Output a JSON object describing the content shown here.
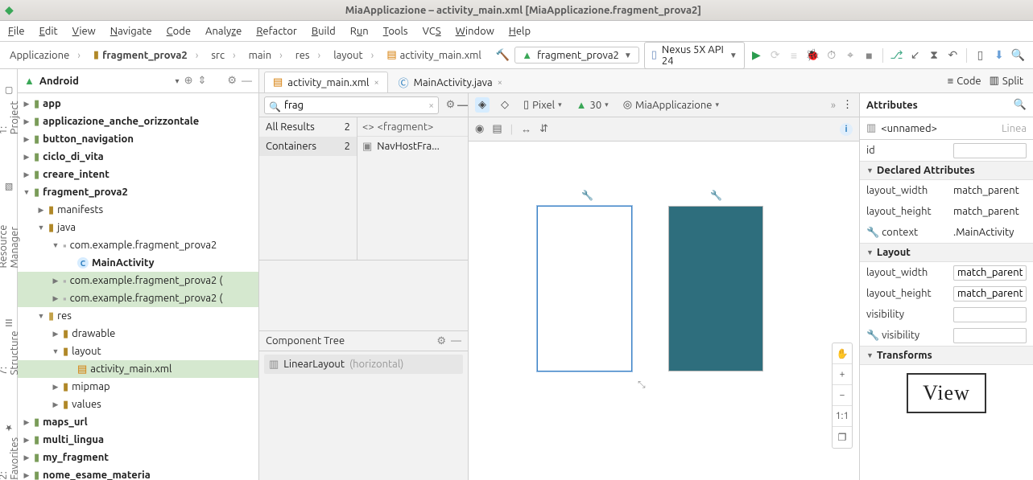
{
  "window": {
    "title": "MiaApplicazione – activity_main.xml [MiaApplicazione.fragment_prova2]"
  },
  "menu": {
    "file": "File",
    "edit": "Edit",
    "view": "View",
    "navigate": "Navigate",
    "code": "Code",
    "analyze": "Analyze",
    "refactor": "Refactor",
    "build": "Build",
    "run": "Run",
    "tools": "Tools",
    "vcs": "VCS",
    "window": "Window",
    "help": "Help"
  },
  "breadcrumbs": [
    "Applicazione",
    "fragment_prova2",
    "src",
    "main",
    "res",
    "layout",
    "activity_main.xml"
  ],
  "run_config": "fragment_prova2",
  "device": "Nexus 5X API 24",
  "proj_header": "Android",
  "left_tabs": {
    "project": "1: Project",
    "resmgr": "Resource Manager",
    "structure": "7: Structure",
    "fav": "2: Favorites"
  },
  "project_tree": [
    {
      "lvl": 0,
      "label": "app",
      "icon": "mod",
      "exp": "▶"
    },
    {
      "lvl": 0,
      "label": "applicazione_anche_orizzontale",
      "icon": "mod",
      "exp": "▶"
    },
    {
      "lvl": 0,
      "label": "button_navigation",
      "icon": "mod",
      "exp": "▶"
    },
    {
      "lvl": 0,
      "label": "ciclo_di_vita",
      "icon": "mod",
      "exp": "▶"
    },
    {
      "lvl": 0,
      "label": "creare_intent",
      "icon": "mod",
      "exp": "▶"
    },
    {
      "lvl": 0,
      "label": "fragment_prova2",
      "icon": "mod",
      "exp": "▼"
    },
    {
      "lvl": 1,
      "label": "manifests",
      "icon": "fold",
      "exp": "▶"
    },
    {
      "lvl": 1,
      "label": "java",
      "icon": "fold",
      "exp": "▼"
    },
    {
      "lvl": 2,
      "label": "com.example.fragment_prova2",
      "icon": "pkg",
      "exp": "▼"
    },
    {
      "lvl": 3,
      "label": "MainActivity",
      "icon": "class",
      "exp": ""
    },
    {
      "lvl": 2,
      "label": "com.example.fragment_prova2 (",
      "icon": "pkg",
      "exp": "▶",
      "sel": true
    },
    {
      "lvl": 2,
      "label": "com.example.fragment_prova2 (",
      "icon": "pkg",
      "exp": "▶",
      "sel": true
    },
    {
      "lvl": 1,
      "label": "res",
      "icon": "res",
      "exp": "▼"
    },
    {
      "lvl": 2,
      "label": "drawable",
      "icon": "fold",
      "exp": "▶"
    },
    {
      "lvl": 2,
      "label": "layout",
      "icon": "fold",
      "exp": "▼"
    },
    {
      "lvl": 3,
      "label": "activity_main.xml",
      "icon": "file",
      "exp": "",
      "sel": true
    },
    {
      "lvl": 2,
      "label": "mipmap",
      "icon": "fold",
      "exp": "▶"
    },
    {
      "lvl": 2,
      "label": "values",
      "icon": "fold",
      "exp": "▶"
    },
    {
      "lvl": 0,
      "label": "maps_url",
      "icon": "mod",
      "exp": "▶"
    },
    {
      "lvl": 0,
      "label": "multi_lingua",
      "icon": "mod",
      "exp": "▶"
    },
    {
      "lvl": 0,
      "label": "my_fragment",
      "icon": "mod",
      "exp": "▶"
    },
    {
      "lvl": 0,
      "label": "nome_esame_materia",
      "icon": "mod",
      "exp": "▶"
    }
  ],
  "tabs": [
    {
      "label": "activity_main.xml",
      "icon": "xml",
      "active": true
    },
    {
      "label": "MainActivity.java",
      "icon": "java",
      "active": false
    }
  ],
  "view_modes": {
    "code": "Code",
    "split": "Split"
  },
  "palette": {
    "search_value": "frag",
    "all_results": "All Results",
    "all_results_n": "2",
    "containers": "Containers",
    "containers_n": "2",
    "fragment_hdr": "<fragment>",
    "navhost": "NavHostFra..."
  },
  "component_tree": {
    "title": "Component Tree",
    "root": "LinearLayout",
    "root_note": "(horizontal)"
  },
  "design_top": {
    "pixel": "Pixel",
    "api": "30",
    "app": "MiaApplicazione"
  },
  "zoom": {
    "plus": "+",
    "minus": "−",
    "fit": "1:1",
    "expand": "❐",
    "pan": "✋"
  },
  "attrs": {
    "title": "Attributes",
    "selection": "<unnamed>",
    "selection_type": "Linea",
    "id_label": "id",
    "id_value": "",
    "declared": "Declared Attributes",
    "lw": "layout_width",
    "lw_v": "match_parent",
    "lh": "layout_height",
    "lh_v": "match_parent",
    "ctx": "context",
    "ctx_v": ".MainActivity",
    "layout_sect": "Layout",
    "l_lw": "layout_width",
    "l_lw_v": "match_parent",
    "l_lh": "layout_height",
    "l_lh_v": "match_parent",
    "vis": "visibility",
    "vis_v": "",
    "tvis": "visibility",
    "tvis_v": "",
    "transforms": "Transforms",
    "preview": "View"
  }
}
